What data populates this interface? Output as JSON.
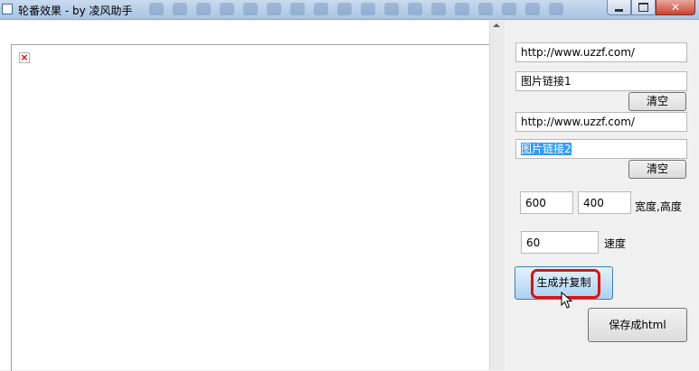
{
  "window": {
    "title": "轮番效果 - by 凌风助手"
  },
  "right_panel": {
    "url1": "http://www.uzzf.com/",
    "image_link1": "图片链接1",
    "clear1": "清空",
    "url2": "http://www.uzzf.com/",
    "image_link2": "图片链接2",
    "clear2": "清空",
    "width": "600",
    "height": "400",
    "size_label": "宽度,高度",
    "speed": "60",
    "speed_label": "速度",
    "generate_copy": "生成并复制",
    "save_html": "保存成html"
  }
}
